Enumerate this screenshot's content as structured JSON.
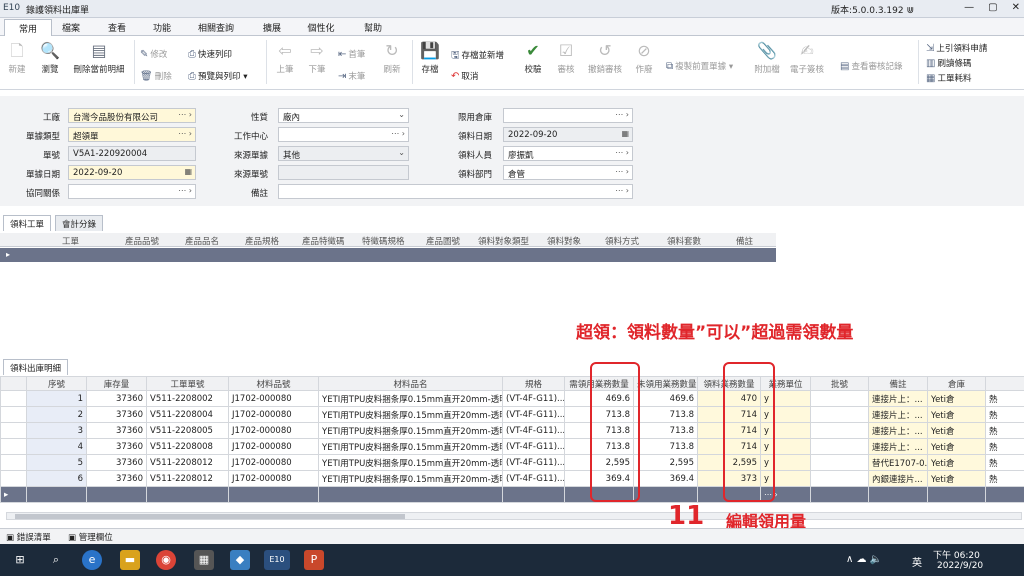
{
  "window": {
    "app_code": "E10",
    "title": "錄護領料出庫單",
    "version": "版本:5.0.0.3.192 ⋓",
    "minimize": "—",
    "maximize": "▢",
    "close": "✕"
  },
  "tabs": [
    "常用",
    "檔案",
    "查看",
    "功能",
    "相關查詢",
    "擴展",
    "個性化",
    "幫助"
  ],
  "ribbon": {
    "new": "新建",
    "browse": "瀏覽",
    "delete_current": "刪除當前明細",
    "modify": "修改",
    "delete": "刪除",
    "quick_print": "快速列印",
    "preview_print": "預覽與列印 ▾",
    "prev": "上筆",
    "next": "下筆",
    "first": "首筆",
    "last": "末筆",
    "refresh": "刷新",
    "save": "存檔",
    "save_new": "存檔並新增",
    "cancel": "取消",
    "verify": "校驗",
    "approve": "審核",
    "unapprove": "撤銷審核",
    "void": "作廢",
    "copy_prev": "複製前置單據 ▾",
    "attachment": "附加檔",
    "esign": "電子簽核",
    "view_approval": "查看審核記錄",
    "prev_doc": "上引領料申請",
    "barcode": "刷讀條碼",
    "work_material": "工單耗料"
  },
  "form": {
    "factory_label": "工廠",
    "factory_value": "台灣今品股份有限公司",
    "doctype_label": "單據類型",
    "doctype_value": "超領單",
    "docno_label": "單號",
    "docno_value": "V5A1-220920004",
    "docdate_label": "單據日期",
    "docdate_value": "2022-09-20",
    "partner_label": "協同關係",
    "partner_value": "",
    "nature_label": "性質",
    "nature_value": "廠內",
    "workcenter_label": "工作中心",
    "workcenter_value": "",
    "source_type_label": "來源單據",
    "source_type_value": "其他",
    "source_no_label": "來源單號",
    "source_no_value": "",
    "remark_label": "備註",
    "remark_value": "",
    "warehouse_label": "限用倉庫",
    "warehouse_value": "",
    "issue_date_label": "領料日期",
    "issue_date_value": "2022-09-20",
    "issuer_label": "領料人員",
    "issuer_value": "廖振凱",
    "dept_label": "領料部門",
    "dept_value": "倉管"
  },
  "section1": {
    "tabs": [
      "領料工單",
      "會計分錄"
    ],
    "columns": [
      "工單",
      "產品品號",
      "產品品名",
      "產品規格",
      "產品特徵碼",
      "特徵碼規格",
      "產品圖號",
      "領料對象類型",
      "領料對象",
      "領料方式",
      "領料套數",
      "備註"
    ]
  },
  "annotation1": "超領：領料數量”可以”超過需領數量",
  "section2": {
    "tab": "領料出庫明細",
    "columns": [
      "序號",
      "庫存量",
      "工單單號",
      "材料品號",
      "材料品名",
      "規格",
      "需領用業務數量",
      "未領用業務數量",
      "領料業務數量",
      "業務單位",
      "批號",
      "備註",
      "倉庫"
    ],
    "rows": [
      {
        "seq": "1",
        "stock": "37360",
        "wo": "V511-2208002",
        "item": "J1702-000080",
        "name": "YETI用TPU皮料捆条厚0.15mm直开20mm-透明",
        "spec": "(VT-4F-G11)...",
        "need": "469.6",
        "notyet": "469.6",
        "qty": "470",
        "unit": "y",
        "lot": "",
        "remark": "連接片上：...",
        "wh": "Yeti倉",
        "x": "熱"
      },
      {
        "seq": "2",
        "stock": "37360",
        "wo": "V511-2208004",
        "item": "J1702-000080",
        "name": "YETI用TPU皮料捆条厚0.15mm直开20mm-透明",
        "spec": "(VT-4F-G11)...",
        "need": "713.8",
        "notyet": "713.8",
        "qty": "714",
        "unit": "y",
        "lot": "",
        "remark": "連接片上：...",
        "wh": "Yeti倉",
        "x": "熱"
      },
      {
        "seq": "3",
        "stock": "37360",
        "wo": "V511-2208005",
        "item": "J1702-000080",
        "name": "YETI用TPU皮料捆条厚0.15mm直开20mm-透明",
        "spec": "(VT-4F-G11)...",
        "need": "713.8",
        "notyet": "713.8",
        "qty": "714",
        "unit": "y",
        "lot": "",
        "remark": "連接片上：...",
        "wh": "Yeti倉",
        "x": "熱"
      },
      {
        "seq": "4",
        "stock": "37360",
        "wo": "V511-2208008",
        "item": "J1702-000080",
        "name": "YETI用TPU皮料捆条厚0.15mm直开20mm-透明",
        "spec": "(VT-4F-G11)...",
        "need": "713.8",
        "notyet": "713.8",
        "qty": "714",
        "unit": "y",
        "lot": "",
        "remark": "連接片上：...",
        "wh": "Yeti倉",
        "x": "熱"
      },
      {
        "seq": "5",
        "stock": "37360",
        "wo": "V511-2208012",
        "item": "J1702-000080",
        "name": "YETI用TPU皮料捆条厚0.15mm直开20mm-透明",
        "spec": "(VT-4F-G11)...",
        "need": "2,595",
        "notyet": "2,595",
        "qty": "2,595",
        "unit": "y",
        "lot": "",
        "remark": "替代E1707-0...",
        "wh": "Yeti倉",
        "x": "熱"
      },
      {
        "seq": "6",
        "stock": "37360",
        "wo": "V511-2208012",
        "item": "J1702-000080",
        "name": "YETI用TPU皮料捆条厚0.15mm直开20mm-透明",
        "spec": "(VT-4F-G11)...",
        "need": "369.4",
        "notyet": "369.4",
        "qty": "373",
        "unit": "y",
        "lot": "",
        "remark": "內銀連接片...",
        "wh": "Yeti倉",
        "x": "熱"
      }
    ]
  },
  "annotation2_num": "11",
  "annotation2_text": "編輯領用量",
  "status_tabs": [
    "錯誤清單",
    "管理欄位"
  ],
  "taskbar": {
    "time": "下午 06:20",
    "date": "2022/9/20",
    "ime": "英",
    "tray": "∧ ☁ 🔈"
  }
}
